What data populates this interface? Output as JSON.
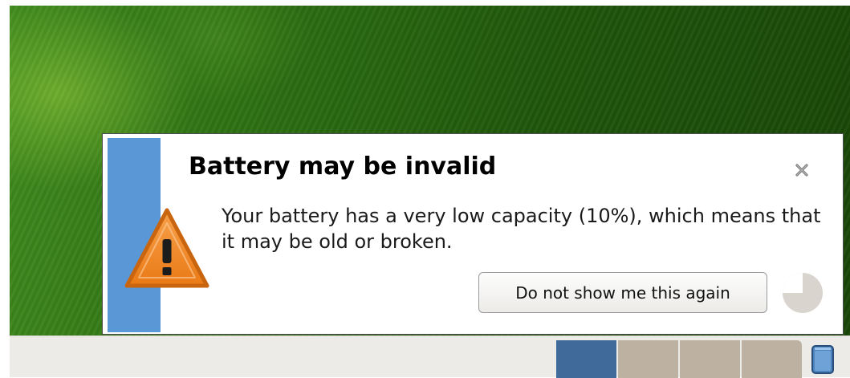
{
  "notification": {
    "title": "Battery may be invalid",
    "body": "Your battery has a very low capacity (10%), which means that it may be old or broken.",
    "action_label": "Do not show me this again",
    "icon": "warning-icon",
    "close_icon": "close-icon",
    "timer_icon": "timer-icon",
    "accent_color": "#5a97d6"
  },
  "panel": {
    "workspaces": [
      {
        "active": true
      },
      {
        "active": false
      },
      {
        "active": false
      },
      {
        "active": false
      }
    ],
    "show_desktop_icon": "show-desktop-icon"
  }
}
